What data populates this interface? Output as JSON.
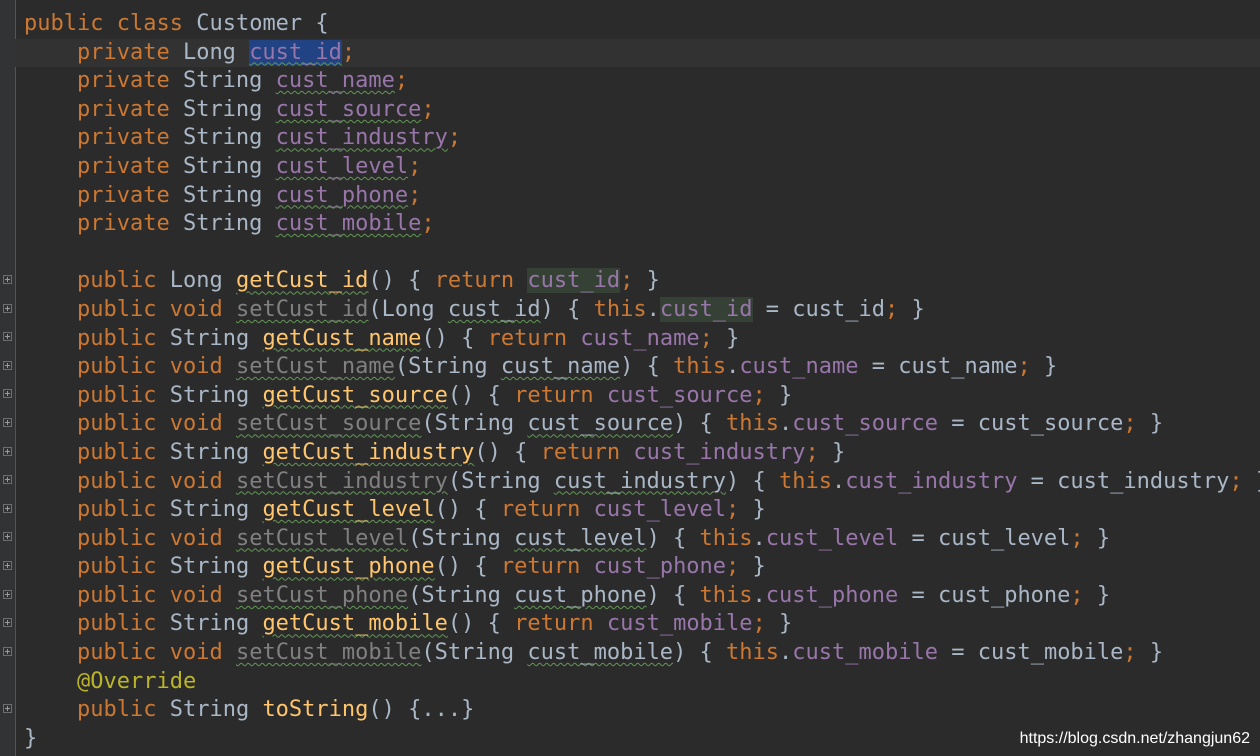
{
  "editor": {
    "lines": [
      "public class Customer {",
      "    private Long cust_id;",
      "    private String cust_name;",
      "    private String cust_source;",
      "    private String cust_industry;",
      "    private String cust_level;",
      "    private String cust_phone;",
      "    private String cust_mobile;",
      "",
      "    public Long getCust_id() { return cust_id; }",
      "    public void setCust_id(Long cust_id) { this.cust_id = cust_id; }",
      "    public String getCust_name() { return cust_name; }",
      "    public void setCust_name(String cust_name) { this.cust_name = cust_name; }",
      "    public String getCust_source() { return cust_source; }",
      "    public void setCust_source(String cust_source) { this.cust_source = cust_source; }",
      "    public String getCust_industry() { return cust_industry; }",
      "    public void setCust_industry(String cust_industry) { this.cust_industry = cust_industry; }",
      "    public String getCust_level() { return cust_level; }",
      "    public void setCust_level(String cust_level) { this.cust_level = cust_level; }",
      "    public String getCust_phone() { return cust_phone; }",
      "    public void setCust_phone(String cust_phone) { this.cust_phone = cust_phone; }",
      "    public String getCust_mobile() { return cust_mobile; }",
      "    public void setCust_mobile(String cust_mobile) { this.cust_mobile = cust_mobile; }",
      "    @Override",
      "    public String toString() {...}",
      "}"
    ],
    "current_line": 1,
    "selected_identifier": "cust_id",
    "folded_lines": [
      9,
      10,
      11,
      12,
      13,
      14,
      15,
      16,
      17,
      18,
      19,
      20,
      21,
      22,
      24
    ]
  },
  "colors": {
    "background": "#2b2b2b",
    "keyword": "#cc7832",
    "field": "#9876aa",
    "method": "#ffc66d",
    "annotation": "#bbb529",
    "plain": "#a9b7c6",
    "unused_method": "#808080",
    "selection": "#214283"
  },
  "watermark": "https://blog.csdn.net/zhangjun62"
}
